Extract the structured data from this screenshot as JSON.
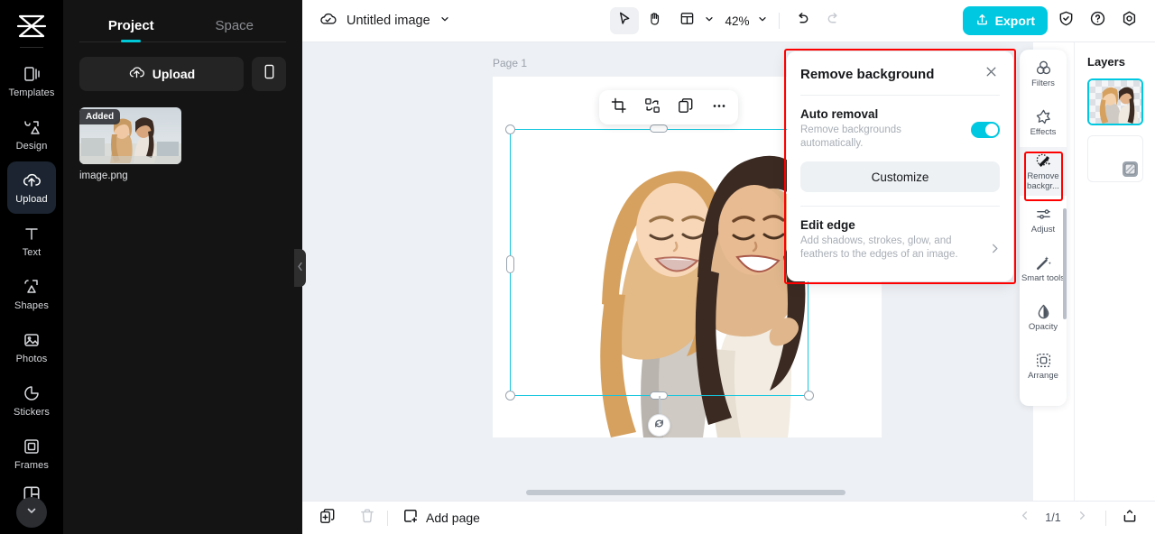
{
  "app": {
    "logo_icon": "capcut-logo-icon"
  },
  "rail": {
    "items": [
      {
        "label": "Templates",
        "icon": "templates-icon",
        "active": false
      },
      {
        "label": "Design",
        "icon": "design-icon",
        "active": false
      },
      {
        "label": "Upload",
        "icon": "upload-cloud-icon",
        "active": true
      },
      {
        "label": "Text",
        "icon": "text-t-icon",
        "active": false
      },
      {
        "label": "Shapes",
        "icon": "shapes-icon",
        "active": false
      },
      {
        "label": "Photos",
        "icon": "photos-image-icon",
        "active": false
      },
      {
        "label": "Stickers",
        "icon": "stickers-icon",
        "active": false
      },
      {
        "label": "Frames",
        "icon": "frames-icon",
        "active": false
      }
    ],
    "more_icon": "chevron-down-icon",
    "last_icon": "layout-grid-icon"
  },
  "panel": {
    "tabs": [
      {
        "label": "Project",
        "active": true
      },
      {
        "label": "Space",
        "active": false
      }
    ],
    "upload_label": "Upload",
    "upload_icon": "upload-cloud-icon",
    "mobile_icon": "mobile-phone-icon",
    "asset": {
      "badge": "Added",
      "name": "image.png"
    },
    "collapse_icon": "chevron-left-icon"
  },
  "topbar": {
    "cloud_icon": "cloud-saved-icon",
    "doc_title": "Untitled image",
    "doc_chevron_icon": "chevron-down-icon",
    "tools": [
      {
        "name": "select-cursor",
        "icon": "cursor-arrow-icon",
        "selected": true
      },
      {
        "name": "hand-pan",
        "icon": "hand-icon",
        "selected": false
      }
    ],
    "layout_icon": "layout-panel-icon",
    "layout_chevron_icon": "chevron-down-icon",
    "zoom_value": "42%",
    "zoom_chevron_icon": "chevron-down-icon",
    "undo_icon": "undo-arrow-icon",
    "redo_icon": "redo-arrow-icon",
    "export_label": "Export",
    "export_icon": "export-upload-icon",
    "export_color": "#00c8e0",
    "shield_icon": "shield-check-icon",
    "help_icon": "question-circle-icon",
    "settings_icon": "settings-gear-icon"
  },
  "canvas": {
    "page_label": "Page 1",
    "background_color": "#edf0f4",
    "selection_color": "#14c6de",
    "float_toolbar": [
      {
        "name": "crop-tool",
        "icon": "crop-icon"
      },
      {
        "name": "replace-tool",
        "icon": "swap-replace-icon"
      },
      {
        "name": "duplicate-tool",
        "icon": "duplicate-icon"
      },
      {
        "name": "more-options",
        "icon": "ellipsis-icon"
      }
    ],
    "rotate_icon": "rotate-handle-icon"
  },
  "toolstrip": {
    "items": [
      {
        "label": "Filters",
        "icon": "filters-circles-icon",
        "selected": false
      },
      {
        "label": "Effects",
        "icon": "effects-star-icon",
        "selected": false
      },
      {
        "label": "Remove backgr...",
        "icon": "magic-eraser-icon",
        "selected": true
      },
      {
        "label": "Adjust",
        "icon": "sliders-icon",
        "selected": false
      },
      {
        "label": "Smart tools",
        "icon": "magic-wand-icon",
        "selected": false
      },
      {
        "label": "Opacity",
        "icon": "opacity-droplet-icon",
        "selected": false
      },
      {
        "label": "Arrange",
        "icon": "arrange-dashed-icon",
        "selected": false
      }
    ],
    "highlight_color": "#ff0000"
  },
  "layers": {
    "title": "Layers",
    "items": [
      {
        "name": "image-layer",
        "selected": true
      },
      {
        "name": "background-layer",
        "selected": false
      }
    ]
  },
  "bottombar": {
    "duplicate_page_icon": "duplicate-page-icon",
    "delete_page_icon": "trash-icon",
    "add_page_label": "Add page",
    "add_page_icon": "add-square-icon",
    "prev_icon": "chevron-left-icon",
    "page_indicator": "1/1",
    "next_icon": "chevron-right-icon",
    "upload_tray_icon": "tray-upload-icon"
  },
  "dialog": {
    "title": "Remove background",
    "close_icon": "close-x-icon",
    "auto": {
      "title": "Auto removal",
      "desc": "Remove backgrounds automatically.",
      "toggle_on": true,
      "toggle_color": "#00c8e0"
    },
    "customize_label": "Customize",
    "edge": {
      "title": "Edit edge",
      "desc": "Add shadows, strokes, glow, and feathers to the edges of an image.",
      "chevron_icon": "chevron-right-icon"
    },
    "highlight_color": "#ff0000"
  }
}
